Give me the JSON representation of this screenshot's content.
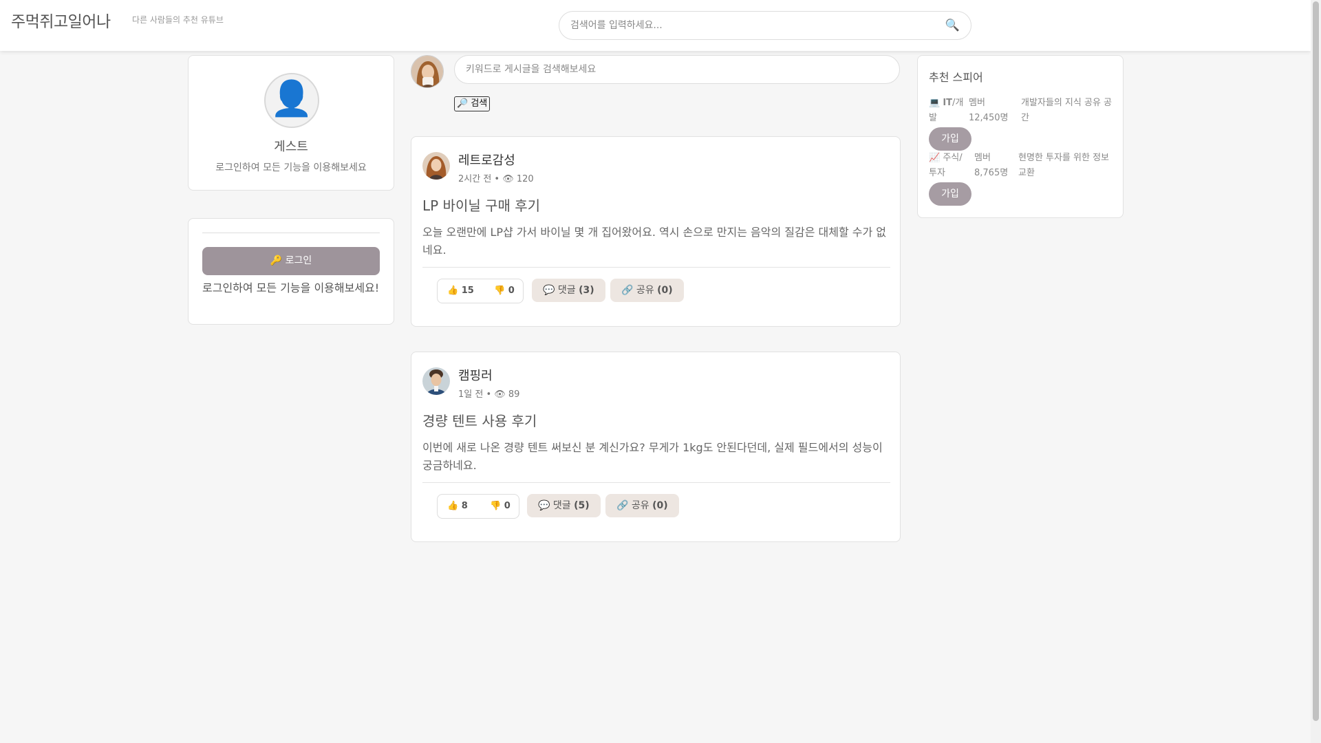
{
  "header": {
    "logo": "주먹쥐고일어나",
    "tagline": "다른 사람들의 추천 유튜브",
    "search_placeholder": "검색어를 입력하세요..."
  },
  "profile": {
    "name": "게스트",
    "hint": "로그인하여 모든 기능을 이용해보세요"
  },
  "login": {
    "button_label": "🔑 로그인",
    "message": "로그인하여 모든 기능을 이용해보세요!"
  },
  "feed": {
    "search_placeholder": "키워드로 게시글을 검색해보세요",
    "search_button": "🔎 검색",
    "posts": [
      {
        "author": "레트로감성",
        "meta": "2시간 전 • 👁 120",
        "title": "LP 바이닐 구매 후기",
        "body": "오늘 오랜만에 LP샵 가서 바이닐 몇 개 집어왔어요. 역시 손으로 만지는 음악의 질감은 대체할 수가 없네요.",
        "likes": "👍 15",
        "dislikes": "👎 0",
        "comments_label": "💬 댓글 ",
        "comments_count": "(3)",
        "share_label": "🔗 공유 ",
        "share_count": "(0)"
      },
      {
        "author": "캠핑러",
        "meta": "1일 전 • 👁 89",
        "title": "경량 텐트 사용 후기",
        "body": "이번에 새로 나온 경량 텐트 써보신 분 계신가요? 무게가 1kg도 안된다던데, 실제 필드에서의 성능이 궁금하네요.",
        "likes": "👍 8",
        "dislikes": "👎 0",
        "comments_label": "💬 댓글 ",
        "comments_count": "(5)",
        "share_label": "🔗 공유 ",
        "share_count": "(0)"
      }
    ]
  },
  "recommend": {
    "title": "추천 스피어",
    "spaces": [
      {
        "icon": "💻",
        "category_bold": "IT",
        "category_rest": "/개발",
        "members": "멤버 12,450명",
        "description": "개발자들의 지식 공유 공간",
        "join_label": "가입"
      },
      {
        "icon": "📈",
        "category_bold": "",
        "category_rest": "주식/투자",
        "members": "멤버 8,765명",
        "description": "현명한 투자를 위한 정보 교환",
        "join_label": "가입"
      }
    ]
  },
  "colors": {
    "accent": "#9e949b",
    "pill_bg": "#ede6e1",
    "person_icon": "#1a6fbf"
  }
}
